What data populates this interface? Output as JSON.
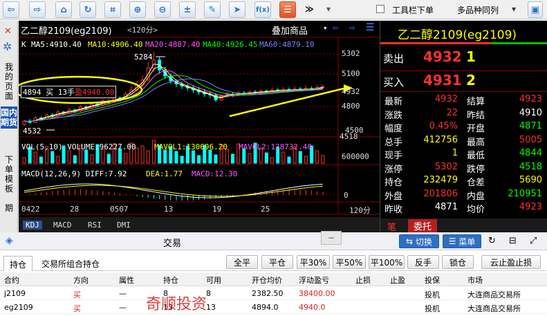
{
  "toolbar": {
    "toolbar_menu_label": "工具栏下单",
    "product_select_value": "多品种同列",
    "more_label": "≫"
  },
  "leftbar": {
    "my_page": "我的页面",
    "domestic_futures": "国内期货",
    "order_template": "下单模板",
    "period": "期"
  },
  "chart": {
    "title": "乙二醇2109(eg2109)",
    "period": "<120分>",
    "overlay_label": "叠加商品",
    "ma_prefix": "K",
    "ma": [
      {
        "label": "MA5:4910.40",
        "color": "#ffffff"
      },
      {
        "label": "MA10:4906.40",
        "color": "#ffff00"
      },
      {
        "label": "MA20:4887.40",
        "color": "#ff55ff"
      },
      {
        "label": "MA40:4926.45",
        "color": "#00ff00"
      },
      {
        "label": "MA60:4879.10",
        "color": "#8080ff"
      }
    ],
    "price_axis": [
      "5302",
      "5100",
      "4932",
      "4800",
      "4500",
      "4518"
    ],
    "high_marker": "5284",
    "low_marker": "4532",
    "position_tag": "4894 买 13手",
    "position_tag_profit": "盈4940.00",
    "vol_label": "VOL(5,10) VOLUME:96227.00",
    "vol_ma1": "MAVOL1:130696.20",
    "vol_ma2": "MAVOL2:138732.40",
    "vol_axis": "600000",
    "macd_label": "MACD(12,26,9) DIFF:7.92",
    "macd_dea": "DEA:1.77",
    "macd_val": "MACD:12.30",
    "macd_axis": "0",
    "dates": [
      "0422",
      "28",
      "0507",
      "13",
      "19",
      "25"
    ],
    "x_unit": "120分",
    "tabs": [
      "KDJ",
      "MACD",
      "RSI",
      "DMI"
    ],
    "watermark": "奇顺投资"
  },
  "quote": {
    "title": "乙二醇2109(eg2109)",
    "ask_label": "卖出",
    "ask_price": "4932",
    "ask_vol": "1",
    "bid_label": "买入",
    "bid_price": "4931",
    "bid_vol": "2",
    "rows": [
      {
        "l1": "最新",
        "v1": "4932",
        "c1": "#ff3030",
        "l2": "结算",
        "v2": "4923",
        "c2": "#ff3030"
      },
      {
        "l1": "涨跌",
        "v1": "22",
        "c1": "#ff3030",
        "l2": "昨结",
        "v2": "4910",
        "c2": "#ffffff"
      },
      {
        "l1": "幅度",
        "v1": "0.45%",
        "c1": "#ff3030",
        "l2": "开盘",
        "v2": "4871",
        "c2": "#00ff00"
      },
      {
        "l1": "总手",
        "v1": "412756",
        "c1": "#ffff00",
        "l2": "最高",
        "v2": "5005",
        "c2": "#ff3030"
      },
      {
        "l1": "现手",
        "v1": "1",
        "c1": "#ffff00",
        "l2": "最低",
        "v2": "4844",
        "c2": "#00ff00"
      },
      {
        "l1": "涨停",
        "v1": "5302",
        "c1": "#ff3030",
        "l2": "跌停",
        "v2": "4518",
        "c2": "#00ff00"
      },
      {
        "l1": "持仓",
        "v1": "232479",
        "c1": "#ffff00",
        "l2": "仓差",
        "v2": "5690",
        "c2": "#ffff00"
      },
      {
        "l1": "外盘",
        "v1": "201806",
        "c1": "#ff3030",
        "l2": "内盘",
        "v2": "210951",
        "c2": "#00ff00"
      },
      {
        "l1": "昨收",
        "v1": "4871",
        "c1": "#ffffff",
        "l2": "均价",
        "v2": "4923",
        "c2": "#ff3030"
      }
    ],
    "tab_pen": "笔",
    "tab_order": "委托"
  },
  "trade": {
    "title": "交易",
    "switch_label": "切换",
    "menu_label": "菜单",
    "tabs": [
      "持仓",
      "交易所组合持仓"
    ],
    "actions": [
      "全平",
      "平仓",
      "平30%",
      "平50%",
      "平100%",
      "反手",
      "锁仓",
      "云止盈止损"
    ],
    "headers": [
      "合约",
      "方向",
      "属性",
      "持仓",
      "可用",
      "开仓均价",
      "浮动盈亏",
      "止损",
      "止盈",
      "投保",
      "市场"
    ],
    "rows": [
      [
        "j2109",
        "买",
        "—",
        "8",
        "8",
        "2382.50",
        "38400.00",
        "",
        "",
        "投机",
        "大连商品交易所"
      ],
      [
        "eg2109",
        "买",
        "—",
        "13",
        "13",
        "4894.0",
        "4940.0",
        "",
        "",
        "投机",
        "大连商品交易所"
      ]
    ]
  }
}
